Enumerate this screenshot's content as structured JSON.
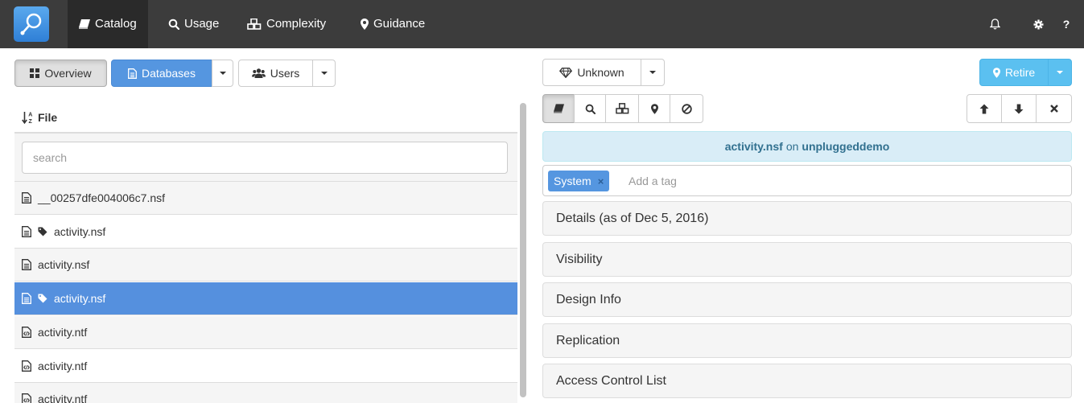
{
  "navbar": {
    "items": [
      {
        "label": "Catalog",
        "icon": "book-icon"
      },
      {
        "label": "Usage",
        "icon": "search-icon"
      },
      {
        "label": "Complexity",
        "icon": "cubes-icon"
      },
      {
        "label": "Guidance",
        "icon": "map-marker-icon"
      }
    ],
    "help_label": "?"
  },
  "left": {
    "overview_label": "Overview",
    "databases_label": "Databases",
    "users_label": "Users",
    "file_header": "File",
    "search_placeholder": "search",
    "files": [
      {
        "name": "__00257dfe004006c7.nsf",
        "type": "nsf",
        "tagged": false
      },
      {
        "name": "activity.nsf",
        "type": "nsf",
        "tagged": true
      },
      {
        "name": "activity.nsf",
        "type": "nsf",
        "tagged": false
      },
      {
        "name": "activity.nsf",
        "type": "nsf",
        "tagged": true,
        "selected": true
      },
      {
        "name": "activity.ntf",
        "type": "ntf",
        "tagged": false
      },
      {
        "name": "activity.ntf",
        "type": "ntf",
        "tagged": false
      },
      {
        "name": "activity.ntf",
        "type": "ntf",
        "tagged": false
      }
    ]
  },
  "right": {
    "status_label": "Unknown",
    "retire_label": "Retire",
    "title": {
      "file": "activity.nsf",
      "connector": "on",
      "server": "unpluggeddemo"
    },
    "tags": [
      {
        "label": "System",
        "remove": "×"
      }
    ],
    "tag_placeholder": "Add a tag",
    "panels": [
      {
        "label": "Details (as of Dec 5, 2016)"
      },
      {
        "label": "Visibility"
      },
      {
        "label": "Design Info"
      },
      {
        "label": "Replication"
      },
      {
        "label": "Access Control List"
      }
    ]
  },
  "colors": {
    "navbar_bg": "#3c3c3c",
    "primary": "#5596e0",
    "info": "#5bc0f0",
    "selected_row": "#5590de",
    "title_bar_bg": "#d9edf7",
    "title_bar_text": "#31708f"
  }
}
